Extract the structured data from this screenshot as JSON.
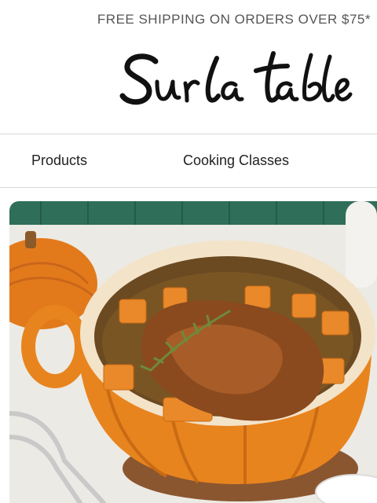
{
  "promo": {
    "text": "FREE SHIPPING ON ORDERS OVER $75*"
  },
  "brand": {
    "name": "Sur la table",
    "logo_color": "#111111"
  },
  "nav": {
    "items": [
      {
        "label": "Products"
      },
      {
        "label": "Cooking Classes"
      }
    ]
  },
  "hero": {
    "icon": "pumpkin-dutch-oven-image",
    "colors": {
      "pot": "#e8841e",
      "tile": "#2f6f5a",
      "counter": "#eceae4"
    }
  }
}
